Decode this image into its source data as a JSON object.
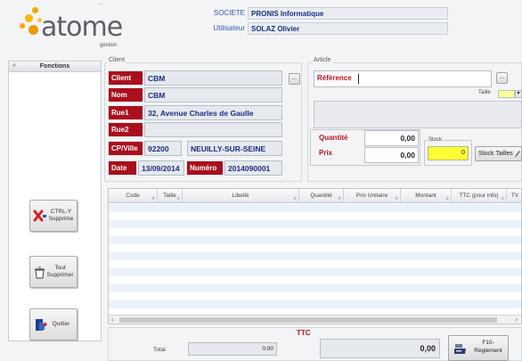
{
  "header": {
    "top_cut_text": "...",
    "societe_label": "SOCIETE",
    "societe_value": "PRONIS Informatique",
    "utilisateur_label": "Utilisateur",
    "utilisateur_value": "SOLAZ Olivier",
    "logo_text": "atome",
    "logo_sub": "gestion"
  },
  "sidebar": {
    "title": "Fonctions",
    "collapse_glyph": "«",
    "buttons": [
      {
        "label_line1": "CTRL-Y",
        "label_line2": "Supprime"
      },
      {
        "label_line1": "Tout",
        "label_line2": "Supprimer"
      },
      {
        "label_line1": "Quitter",
        "label_line2": ""
      }
    ]
  },
  "client": {
    "group_title": "Client",
    "client_label": "Client",
    "client_value": "CBM",
    "nom_label": "Nom",
    "nom_value": "CBM",
    "rue1_label": "Rue1",
    "rue1_value": "32, Avenue Charles de Gaulle",
    "rue2_label": "Rue2",
    "rue2_value": "",
    "cpville_label": "CP/Ville",
    "cp_value": "92200",
    "ville_value": "NEUILLY-SUR-SEINE",
    "date_label": "Date",
    "date_value": "13/09/2014",
    "numero_label": "Numéro",
    "numero_value": "2014090001",
    "lookup_glyph": "..."
  },
  "article": {
    "group_title": "Article",
    "reference_label": "Référence",
    "reference_value": "",
    "taille_label": "Taille",
    "quantite_label": "Quantité",
    "quantite_value": "0,00",
    "prix_label": "Prix",
    "prix_value": "0,00",
    "stock_label": "Stock",
    "stock_value": "0",
    "stock_tailles_label": "Stock Tailles",
    "lookup_glyph": "..."
  },
  "grid": {
    "columns": [
      "Code",
      "Taille",
      "Libellé",
      "Quantité",
      "Prix Unitaire",
      "Montant",
      "TTC (pour info)",
      "TV"
    ],
    "sort_glyph": "⌕",
    "scroll_left": "‹",
    "scroll_right": "›"
  },
  "footer": {
    "total_label": "Total",
    "total_value": "0.00",
    "ttc_label": "TTC",
    "ttc_value": "0,00",
    "reglement_line1": "F10-",
    "reglement_line2": "Règlement"
  },
  "colors": {
    "label_red": "#a90f1d",
    "value_blue": "#1b2e80",
    "stock_yellow": "#ffff33",
    "grid_stripe": "#eaf2fb"
  }
}
